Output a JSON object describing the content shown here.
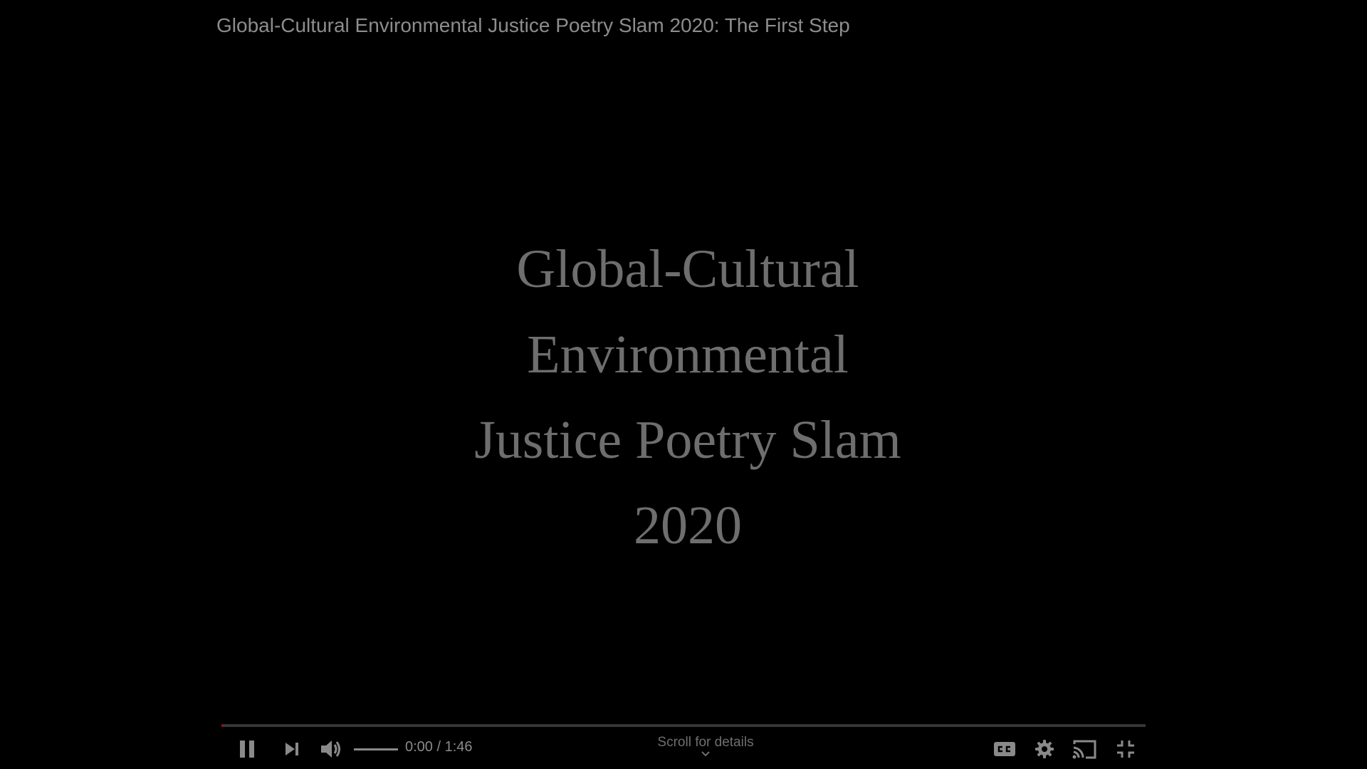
{
  "window": {
    "video_title": "Global-Cultural Environmental Justice Poetry Slam 2020: The First Step"
  },
  "slide": {
    "lines": [
      "Global-Cultural",
      "Environmental",
      "Justice Poetry Slam",
      "2020"
    ]
  },
  "player": {
    "current_time": "0:00",
    "separator": "/",
    "duration": "1:46",
    "time_display": "0:00 / 1:46",
    "progress_fraction": 0.0,
    "volume_fraction": 1.0,
    "scroll_hint": "Scroll for details",
    "icons": {
      "pause": "pause-icon",
      "next": "next-icon",
      "volume": "volume-icon",
      "captions": "captions-icon",
      "settings": "gear-icon",
      "cast": "cast-icon",
      "exit_fullscreen": "exit-fullscreen-icon"
    },
    "colors": {
      "icon": "#8a8a8a",
      "progress_played": "#7a1a1a",
      "progress_track": "#5a5a5a"
    }
  }
}
